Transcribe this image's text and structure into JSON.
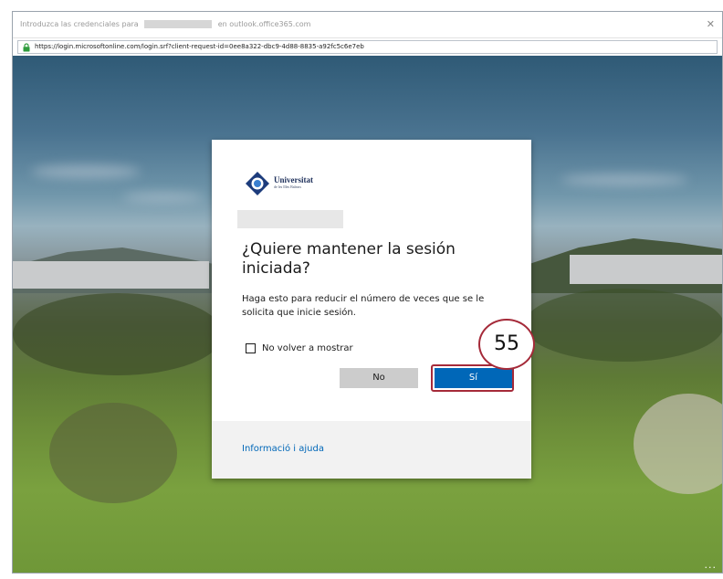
{
  "window": {
    "title_prefix": "Introduzca las credenciales para",
    "title_suffix": "en outlook.office365.com",
    "close_glyph": "✕"
  },
  "address_bar": {
    "url": "https://login.microsoftonline.com/login.srf?client-request-id=0ee8a322-dbc9-4d88-8835-a92fc5c6e7eb"
  },
  "dialog": {
    "logo_text": "Universitat",
    "logo_subtext": "de les Illes Balears",
    "title": "¿Quiere mantener la sesión iniciada?",
    "description": "Haga esto para reducir el número de veces que se le solicita que inicie sesión.",
    "checkbox_label": "No volver a mostrar",
    "no_button": "No",
    "yes_button": "Sí",
    "help_link": "Informació i ajuda"
  },
  "annotation": {
    "step_number": "55",
    "color": "#a52a39"
  },
  "colors": {
    "primary_button": "#0067b8",
    "secondary_button": "#cccccc",
    "link": "#0067b8"
  },
  "more_options": "..."
}
